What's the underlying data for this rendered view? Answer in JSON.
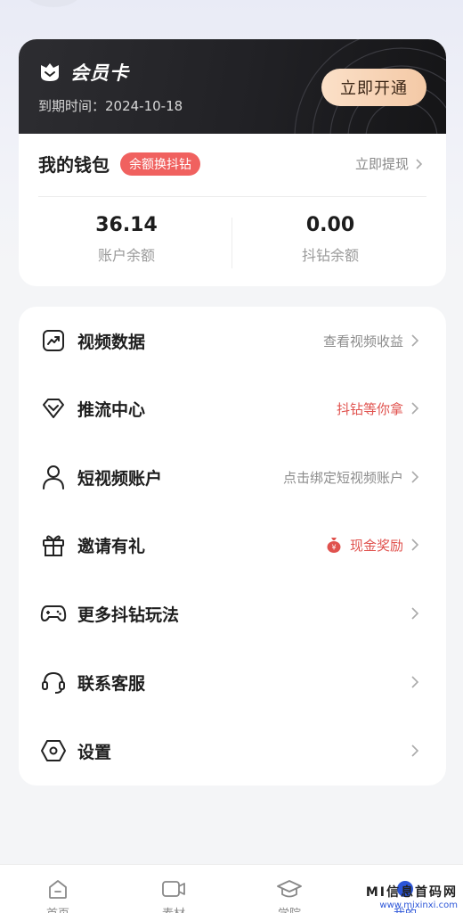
{
  "member": {
    "title": "会员卡",
    "expire": "到期时间：2024-10-18",
    "open_button": "立即开通"
  },
  "wallet": {
    "title": "我的钱包",
    "swap_badge": "余额换抖钻",
    "withdraw": "立即提现",
    "balance_value": "36.14",
    "balance_label": "账户余额",
    "diamond_value": "0.00",
    "diamond_label": "抖钻余额"
  },
  "menu": [
    {
      "label": "视频数据",
      "right": "查看视频收益",
      "icon": "chart-trend-icon",
      "style": "gray"
    },
    {
      "label": "推流中心",
      "right": "抖钻等你拿",
      "icon": "diamond-icon",
      "style": "red"
    },
    {
      "label": "短视频账户",
      "right": "点击绑定短视频账户",
      "icon": "user-icon",
      "style": "gray"
    },
    {
      "label": "邀请有礼",
      "right": "现金奖励",
      "icon": "gift-icon",
      "style": "red",
      "right_icon": "money-bag-icon"
    },
    {
      "label": "更多抖钻玩法",
      "right": "",
      "icon": "gamepad-icon",
      "style": "gray"
    },
    {
      "label": "联系客服",
      "right": "",
      "icon": "headset-icon",
      "style": "gray"
    },
    {
      "label": "设置",
      "right": "",
      "icon": "settings-hexagon-icon",
      "style": "gray"
    }
  ],
  "tabs": [
    {
      "label": "首页",
      "icon": "home-icon"
    },
    {
      "label": "素材",
      "icon": "video-camera-icon"
    },
    {
      "label": "学院",
      "icon": "graduation-cap-icon"
    },
    {
      "label": "我的",
      "icon": "profile-icon"
    }
  ],
  "colors": {
    "accent_red": "#f0615f",
    "gold_button": "#f4c9a6",
    "dark_card": "#212125",
    "active_tab": "#2b55d8"
  },
  "watermark": {
    "main": "MI信息首码网",
    "sub": "www.mixinxi.com"
  }
}
